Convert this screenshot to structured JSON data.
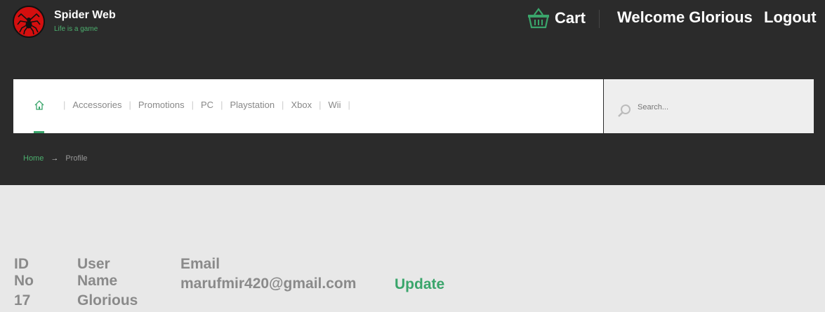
{
  "brand": {
    "title": "Spider Web",
    "tagline": "Life is a game"
  },
  "header": {
    "cart_label": "Cart",
    "welcome_text": "Welcome Glorious",
    "logout_label": "Logout"
  },
  "nav": {
    "items": [
      "Accessories",
      "Promotions",
      "PC",
      "Playstation",
      "Xbox",
      "Wii"
    ]
  },
  "search": {
    "placeholder": "Search..."
  },
  "breadcrumb": {
    "home": "Home",
    "current": "Profile"
  },
  "profile": {
    "id_header": "ID No",
    "id_value": "17",
    "username_header": "User Name",
    "username_value": "Glorious",
    "email_header": "Email",
    "email_value": "marufmir420@gmail.com",
    "update_label": "Update"
  },
  "colors": {
    "accent": "#3aa56b",
    "header_bg": "#2b2b2b",
    "page_bg": "#e8e8e8",
    "logo_red": "#d40f0f"
  }
}
